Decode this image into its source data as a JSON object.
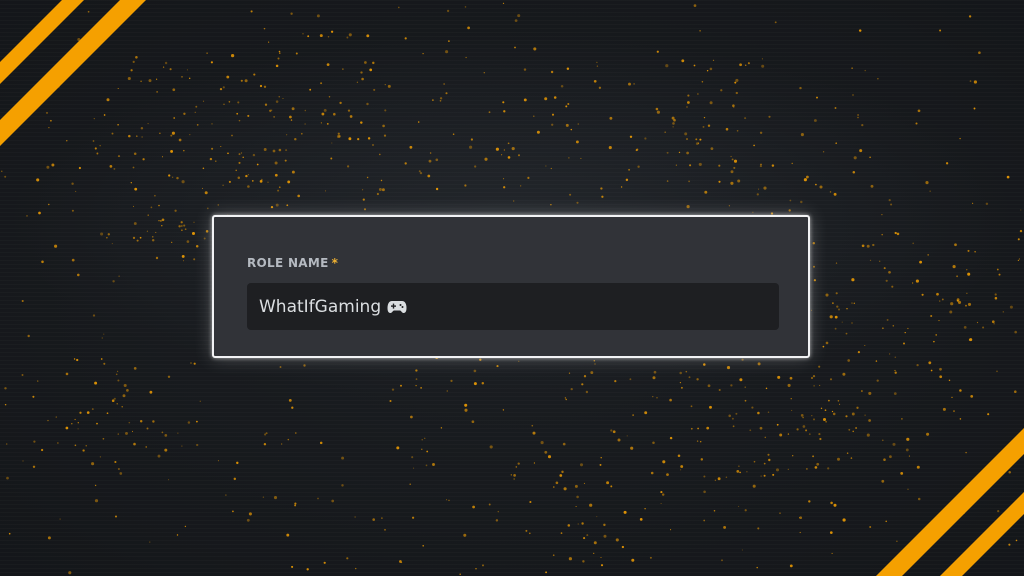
{
  "role_field": {
    "label": "ROLE NAME",
    "required_marker": "*",
    "value": "WhatIfGaming",
    "value_icon": "gamepad-icon"
  },
  "colors": {
    "accent": "#f5a000",
    "card_bg": "#313338",
    "input_bg": "#1e1f22",
    "card_border": "#f2f3f5",
    "label": "#b5bac1",
    "required": "#f0b232"
  }
}
